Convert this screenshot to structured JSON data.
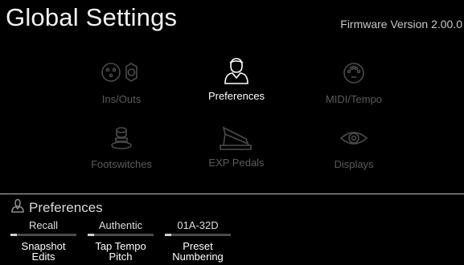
{
  "header": {
    "title": "Global Settings",
    "firmware": "Firmware Version 2.00.0"
  },
  "menu": [
    {
      "label": "Ins/Outs",
      "icon": "xlr-jack-icon",
      "state": "dim"
    },
    {
      "label": "Preferences",
      "icon": "user-icon",
      "state": "active"
    },
    {
      "label": "MIDI/Tempo",
      "icon": "midi-port-icon",
      "state": "dim"
    },
    {
      "label": "Footswitches",
      "icon": "footswitch-icon",
      "state": "dim"
    },
    {
      "label": "EXP Pedals",
      "icon": "expression-pedal-icon",
      "state": "dim"
    },
    {
      "label": "Displays",
      "icon": "eye-icon",
      "state": "dim"
    }
  ],
  "panel": {
    "title": "Preferences",
    "icon": "user-icon",
    "params": [
      {
        "value": "Recall",
        "name_line1": "Snapshot",
        "name_line2": "Edits",
        "level": 0.1
      },
      {
        "value": "Authentic",
        "name_line1": "Tap Tempo",
        "name_line2": "Pitch",
        "level": 0.1
      },
      {
        "value": "01A-32D",
        "name_line1": "Preset",
        "name_line2": "Numbering",
        "level": 0.1
      }
    ]
  },
  "colors": {
    "background": "#000000",
    "active_text": "#ffffff",
    "dim_text": "#5a5a5a",
    "divider": "#bdbdbd"
  }
}
